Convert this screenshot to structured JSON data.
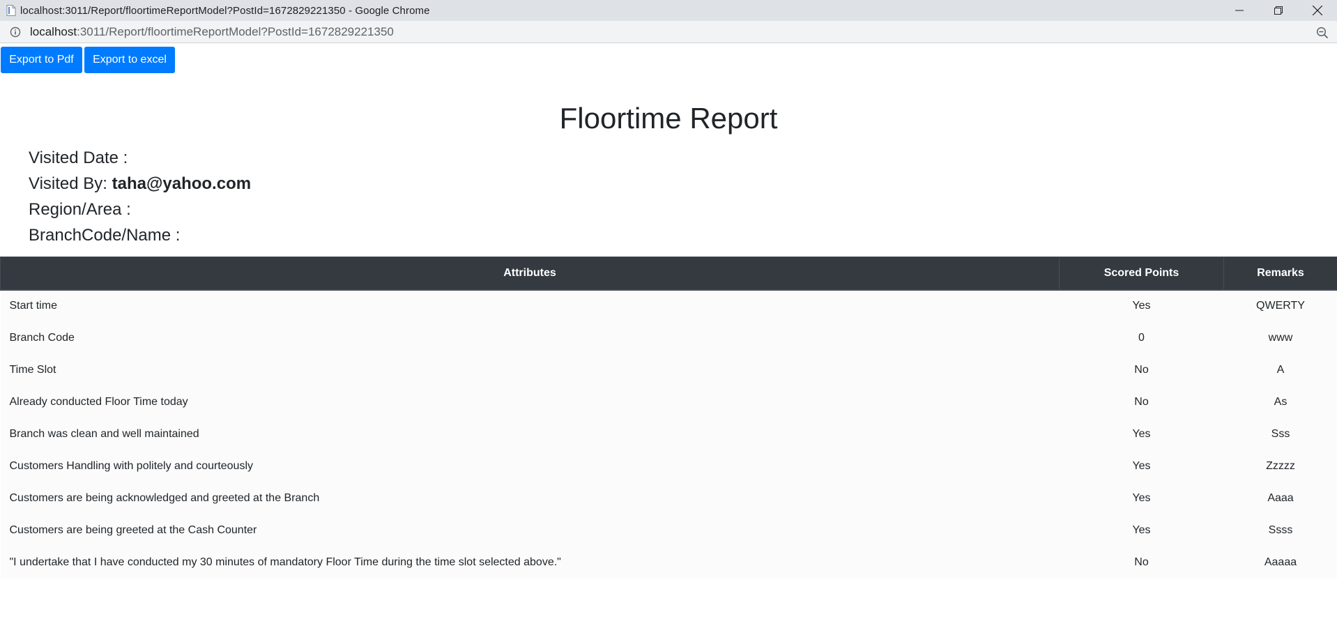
{
  "browser": {
    "window_title": "localhost:3011/Report/floortimeReportModel?PostId=1672829221350 - Google Chrome",
    "url_host": "localhost",
    "url_rest": ":3011/Report/floortimeReportModel?PostId=1672829221350"
  },
  "actions": {
    "export_pdf": "Export to Pdf",
    "export_excel": "Export to excel"
  },
  "report": {
    "title": "Floortime Report",
    "visited_date_label": "Visited Date :",
    "visited_date_value": "",
    "visited_by_label": "Visited By:",
    "visited_by_value": "taha@yahoo.com",
    "region_label": "Region/Area :",
    "region_value": "",
    "branch_label": "BranchCode/Name :",
    "branch_value": ""
  },
  "table": {
    "headers": [
      "Attributes",
      "Scored Points",
      "Remarks"
    ],
    "rows": [
      {
        "attribute": "Start time",
        "score": "Yes",
        "remarks": "QWERTY"
      },
      {
        "attribute": "Branch Code",
        "score": "0",
        "remarks": "www"
      },
      {
        "attribute": "Time Slot",
        "score": "No",
        "remarks": "A"
      },
      {
        "attribute": "Already conducted Floor Time today",
        "score": "No",
        "remarks": "As"
      },
      {
        "attribute": "Branch was clean and well maintained",
        "score": "Yes",
        "remarks": "Sss"
      },
      {
        "attribute": "Customers Handling with politely and courteously",
        "score": "Yes",
        "remarks": "Zzzzz"
      },
      {
        "attribute": "Customers are being acknowledged and greeted at the Branch",
        "score": "Yes",
        "remarks": "Aaaa"
      },
      {
        "attribute": "Customers are being greeted at the Cash Counter",
        "score": "Yes",
        "remarks": "Ssss"
      },
      {
        "attribute": "\"I undertake that I have conducted my 30 minutes of mandatory Floor Time during the time slot selected above.\"",
        "score": "No",
        "remarks": "Aaaaa"
      }
    ]
  },
  "colors": {
    "primary": "#007bff",
    "table_header": "#343a40"
  }
}
